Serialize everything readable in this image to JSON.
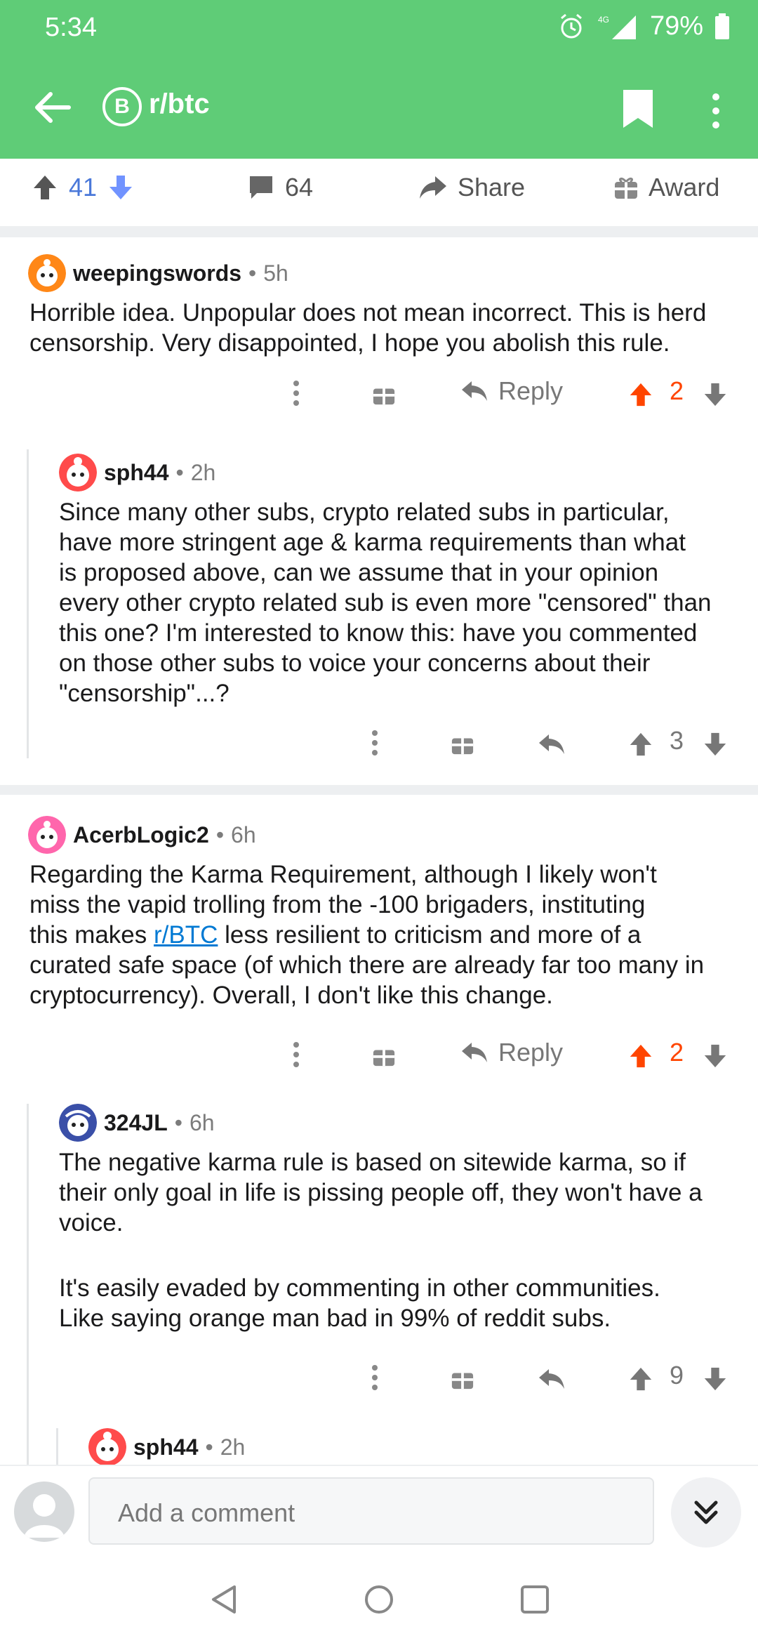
{
  "status_bar": {
    "time": "5:34",
    "network": "4G",
    "battery": "79%"
  },
  "app_bar": {
    "subreddit": "r/btc",
    "sub_icon_letter": "B"
  },
  "post_actions": {
    "score": "41",
    "comments": "64",
    "share": "Share",
    "award": "Award"
  },
  "comments": [
    {
      "user": "weepingswords",
      "time": "5h",
      "lines": [
        "Horrible idea. Unpopular does not mean incorrect. This is herd",
        "censorship. Very disappointed, I hope you abolish this rule."
      ],
      "reply_label": "Reply",
      "score": "2"
    },
    {
      "user": "sph44",
      "time": "2h",
      "lines": [
        "Since many other subs, crypto related subs in particular,",
        "have more stringent age & karma requirements than what",
        "is proposed above, can we assume that in your opinion",
        "every other crypto related sub is even more \"censored\" than",
        "this one?  I'm interested to know this:  have you commented",
        "on those other subs to voice your concerns about their",
        "\"censorship\"...?"
      ],
      "score": "3"
    },
    {
      "user": "AcerbLogic2",
      "time": "6h",
      "line1": "Regarding the Karma Requirement, although I likely won't",
      "line2": "miss the vapid trolling from the -100 brigaders, instituting",
      "line3_pre": "this makes ",
      "line3_link": "r/BTC",
      "line3_post": " less resilient to criticism and more of a",
      "line4": "curated safe space (of which there are already far too many in",
      "line5": "cryptocurrency). Overall, I don't like this change.",
      "reply_label": "Reply",
      "score": "2"
    },
    {
      "user": "324JL",
      "time": "6h",
      "lines": [
        "The negative karma rule is based on sitewide karma, so if",
        "their only goal in life is pissing people off, they won't have a",
        "voice.",
        "",
        "It's easily evaded by commenting in other communities.",
        "Like saying orange man bad in 99% of reddit subs."
      ],
      "score": "9"
    },
    {
      "user": "sph44",
      "time": "2h"
    }
  ],
  "composer": {
    "placeholder": "Add a comment"
  },
  "colors": {
    "header": "#5fcc77",
    "upvote": "#ff4500",
    "downvote_blue": "#7193ff",
    "link": "#0079d3"
  },
  "icons": [
    "back-arrow-icon",
    "bitcoin-icon",
    "bookmark-icon",
    "more-vertical-icon",
    "upvote-icon",
    "downvote-icon",
    "comment-icon",
    "share-icon",
    "gift-icon",
    "reply-icon",
    "chevron-double-down-icon"
  ]
}
